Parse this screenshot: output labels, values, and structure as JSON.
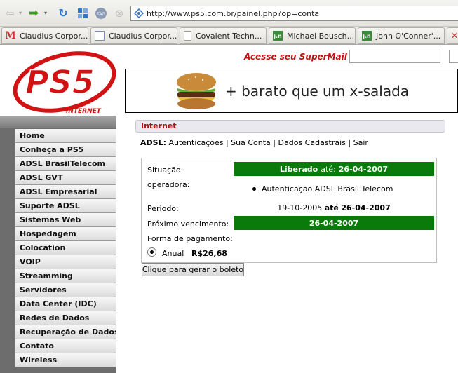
{
  "browser": {
    "url": "http://www.ps5.com.br/painel.php?op=conta",
    "tag_label": "TAG",
    "bookmarks": [
      {
        "label": "Claudius Corpor...",
        "icon": "gmail-icon"
      },
      {
        "label": "Claudius Corpor...",
        "icon": "calendar-icon"
      },
      {
        "label": "Covalent Techn...",
        "icon": "document-icon"
      },
      {
        "label": "Michael Bousch...",
        "icon": "jn-icon"
      },
      {
        "label": "John O'Conner'...",
        "icon": "jn-icon"
      }
    ],
    "jn_icon_text": "j.n"
  },
  "header": {
    "logo_text": "PS5",
    "logo_sub": "INTERNET",
    "supermail_label": "Acesse seu SuperMail"
  },
  "banner": {
    "text": "+ barato que um x-salada"
  },
  "sidebar": {
    "items": [
      "Home",
      "Conheça a PS5",
      "ADSL BrasilTelecom",
      "ADSL GVT",
      "ADSL Empresarial",
      "Suporte ADSL",
      "Sistemas Web",
      "Hospedagem",
      "Colocation",
      "VOIP",
      "Streamming",
      "Servidores",
      "Data Center (IDC)",
      "Redes de Dados",
      "Recuperação de Dados",
      "Contato",
      "Wireless"
    ]
  },
  "main": {
    "section_title": "Internet",
    "adsl_label": "ADSL:",
    "adsl_links": [
      "Autenticações",
      "Sua Conta",
      "Dados Cadastrais",
      "Sair"
    ],
    "situacao_label": "Situação:",
    "situacao_value": "Liberado",
    "situacao_ate": "até:",
    "situacao_date": "26-04-2007",
    "operadora_label": "operadora:",
    "operadora_value": "Autenticação ADSL Brasil Telecom",
    "periodo_label": "Periodo:",
    "periodo_start": "19-10-2005",
    "periodo_ate": "até",
    "periodo_end": "26-04-2007",
    "vencimento_label": "Próximo vencimento:",
    "vencimento_value": "26-04-2007",
    "pagamento_label": "Forma de pagamento:",
    "plan_label": "Anual",
    "plan_price": "R$26,68",
    "generate_button": "Clique para gerar o boleto"
  },
  "colors": {
    "accent_red": "#c01010",
    "status_green": "#0a7a0a",
    "sidebar_gray": "#6d6d6d"
  }
}
